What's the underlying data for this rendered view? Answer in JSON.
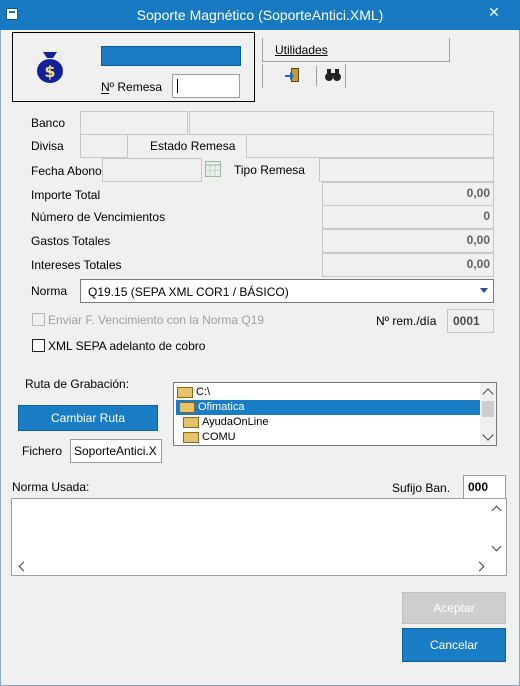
{
  "window": {
    "title": "Soporte Magnético (SoporteAntici.XML)",
    "close": "✕"
  },
  "header": {
    "remesa_label": "Nº Remesa",
    "remesa_value": "",
    "utilidades_label": "Utilidades"
  },
  "form": {
    "banco_label": "Banco",
    "divisa_label": "Divisa",
    "estado_label": "Estado Remesa",
    "fecha_label": "Fecha Abono",
    "tipo_label": "Tipo Remesa",
    "importe_label": "Importe Total",
    "importe_value": "0,00",
    "vencimientos_label": "Número de Vencimientos",
    "vencimientos_value": "0",
    "gastos_label": "Gastos Totales",
    "gastos_value": "0,00",
    "intereses_label": "Intereses Totales",
    "intereses_value": "0,00",
    "norma_label": "Norma",
    "norma_value": "Q19.15 (SEPA XML COR1 / BÁSICO)",
    "enviar_label": "Enviar F. Vencimiento con la Norma Q19",
    "nrem_label": "Nº rem./día",
    "nrem_value": "0001",
    "xml_label": "XML SEPA adelanto de cobro"
  },
  "output": {
    "ruta_label": "Ruta de Grabación:",
    "cambiar_label": "Cambiar Ruta",
    "fichero_label": "Fichero",
    "fichero_value": "SoporteAntici.X",
    "folders": [
      "C:\\",
      "Ofimatica",
      "AyudaOnLine",
      "COMU"
    ]
  },
  "norma_usada": {
    "label": "Norma Usada:",
    "sufijo_label": "Sufijo Ban.",
    "sufijo_value": "000"
  },
  "buttons": {
    "aceptar": "Aceptar",
    "cancelar": "Cancelar"
  },
  "colors": {
    "titlebar": "#1779c1",
    "accent": "#1a7cc4",
    "selection": "#1a7cc4"
  }
}
